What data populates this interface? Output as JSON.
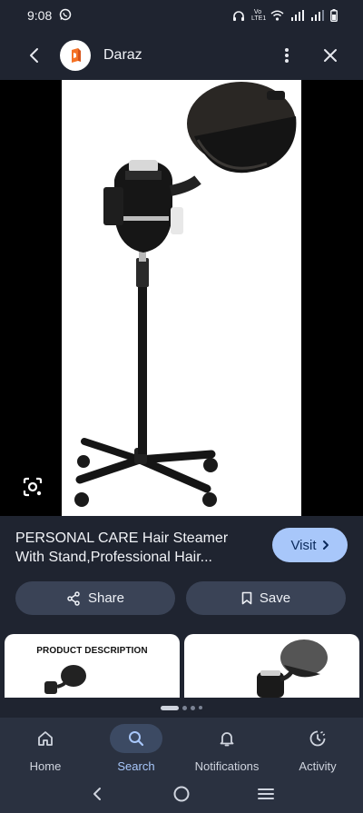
{
  "status_bar": {
    "time": "9:08",
    "network_label": "Vo LTE1",
    "icons": [
      "whatsapp-icon",
      "headphones-icon",
      "wifi-icon",
      "signal-icon",
      "signal-icon",
      "battery-icon"
    ]
  },
  "app_bar": {
    "site_name": "Daraz",
    "icons": [
      "back-arrow-icon",
      "daraz-logo",
      "more-vert-icon",
      "close-icon"
    ]
  },
  "product": {
    "title": "PERSONAL CARE Hair Steamer With Stand,Professional Hair...",
    "visit_label": "Visit",
    "share_label": "Share",
    "save_label": "Save"
  },
  "related": {
    "card_1_caption": "PRODUCT DESCRIPTION"
  },
  "pagination": {
    "count": 4,
    "active_index": 0
  },
  "bottom_nav": {
    "items": [
      {
        "label": "Home",
        "icon": "home-icon"
      },
      {
        "label": "Search",
        "icon": "search-icon"
      },
      {
        "label": "Notifications",
        "icon": "bell-icon"
      },
      {
        "label": "Activity",
        "icon": "activity-icon"
      }
    ],
    "active_index": 1
  },
  "colors": {
    "background": "#1f2430",
    "accent": "#a8c7fa",
    "chip": "#3a4356",
    "daraz_orange": "#f57224"
  }
}
